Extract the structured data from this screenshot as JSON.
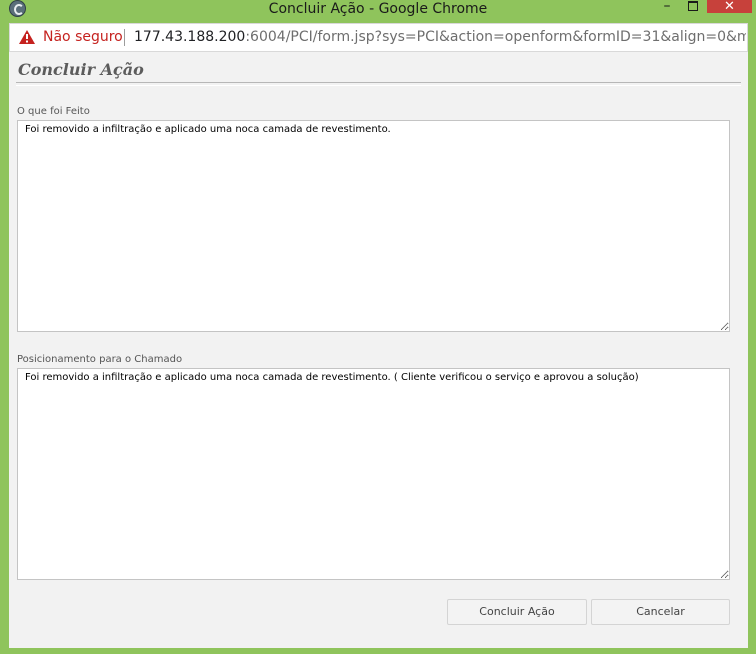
{
  "window": {
    "title": "Concluir Ação - Google Chrome",
    "minimize_glyph": "–",
    "close_glyph": "✕"
  },
  "addressbar": {
    "security_label": "Não seguro",
    "url_host": "177.43.188.200",
    "url_rest": ":6004/PCI/form.jsp?sys=PCI&action=openform&formID=31&align=0&mode=-1..."
  },
  "form": {
    "title": "Concluir Ação",
    "field1": {
      "label": "O que foi Feito",
      "value": "Foi removido a infiltração e aplicado uma noca camada de revestimento."
    },
    "field2": {
      "label": "Posicionamento para o Chamado",
      "value": "Foi removido a infiltração e aplicado uma noca camada de revestimento. ( Cliente verificou o serviço e aprovou a solução)"
    },
    "buttons": {
      "save": "Concluir Ação",
      "cancel": "Cancelar"
    }
  },
  "colors": {
    "window_frame": "#8fc45c",
    "close_button": "#c7413b",
    "warning": "#c5221f"
  }
}
